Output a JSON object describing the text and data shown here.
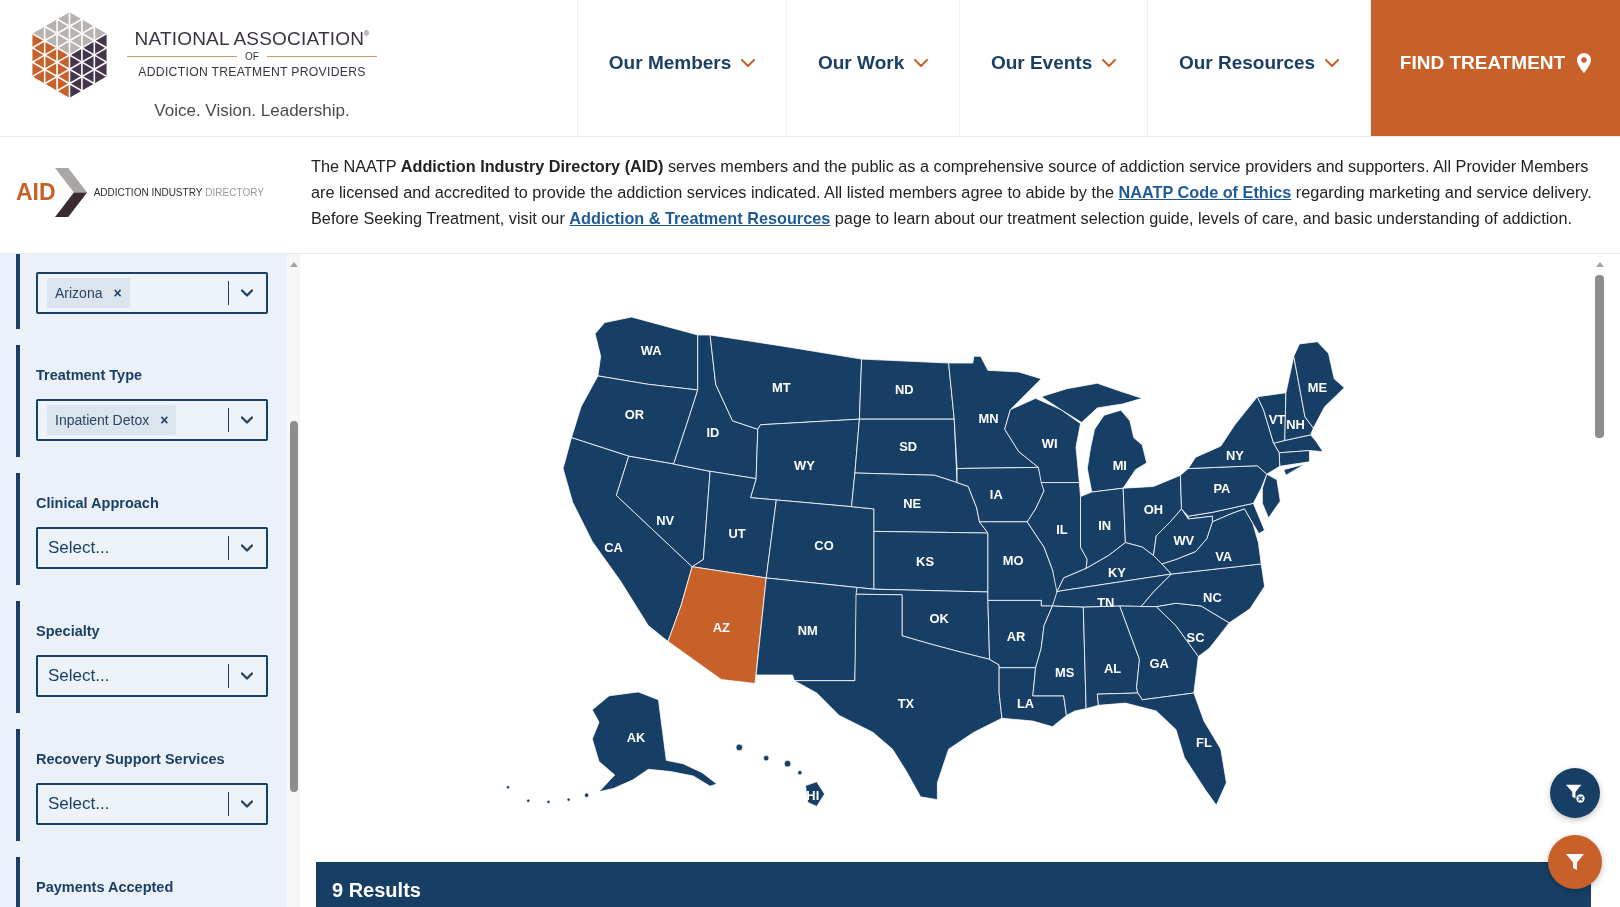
{
  "header": {
    "logo": {
      "title": "NATIONAL ASSOCIATION$^{®}$",
      "connector": "OF",
      "subtitle": "ADDICTION TREATMENT PROVIDERS",
      "tagline": "Voice. Vision. Leadership."
    },
    "nav": [
      {
        "label": "Our Members",
        "kind": "menu"
      },
      {
        "label": "Our Work",
        "kind": "menu"
      },
      {
        "label": "Our Events",
        "kind": "menu"
      },
      {
        "label": "Our Resources",
        "kind": "menu"
      },
      {
        "label": "FIND TREATMENT",
        "kind": "cta"
      }
    ]
  },
  "intro": {
    "logo": {
      "mark": "AID",
      "name": "ADDICTION INDUSTRY",
      "name_accent": "DIRECTORY"
    },
    "paragraph": [
      {
        "kind": "text",
        "text": "The NAATP **Addiction Industry Directory (AID)** serves members and the public as a comprehensive source of addiction service providers and supporters. All Provider Members are licensed and accredited to provide the addiction services indicated. All listed members agree to abide by the "
      },
      {
        "kind": "link",
        "text": "NAATP Code of Ethics"
      },
      {
        "kind": "text",
        "text": " regarding marketing and service delivery. Before Seeking Treatment, visit our "
      },
      {
        "kind": "link",
        "text": "Addiction & Treatment Resources"
      },
      {
        "kind": "text",
        "text": " page to learn about our treatment selection guide, levels of care, and basic understanding of addiction."
      }
    ]
  },
  "filters": [
    {
      "tags": [
        {
          "label": "Arizona",
          "remove": "×"
        }
      ]
    },
    {
      "label": "Treatment Type",
      "tags": [
        {
          "label": "Inpatient Detox",
          "remove": "×"
        }
      ]
    },
    {
      "label": "Clinical Approach",
      "placeholder": "Select..."
    },
    {
      "label": "Specialty",
      "placeholder": "Select..."
    },
    {
      "label": "Recovery Support Services",
      "placeholder": "Select..."
    },
    {
      "label": "Payments Accepted"
    }
  ],
  "map": {
    "states": [
      {
        "code": "WA",
        "selected": false
      },
      {
        "code": "OR",
        "selected": false
      },
      {
        "code": "CA",
        "selected": false
      },
      {
        "code": "NV",
        "selected": false
      },
      {
        "code": "ID",
        "selected": false
      },
      {
        "code": "MT",
        "selected": false
      },
      {
        "code": "WY",
        "selected": false
      },
      {
        "code": "UT",
        "selected": false
      },
      {
        "code": "AZ",
        "selected": true
      },
      {
        "code": "CO",
        "selected": false
      },
      {
        "code": "NM",
        "selected": false
      },
      {
        "code": "ND",
        "selected": false
      },
      {
        "code": "SD",
        "selected": false
      },
      {
        "code": "NE",
        "selected": false
      },
      {
        "code": "KS",
        "selected": false
      },
      {
        "code": "OK",
        "selected": false
      },
      {
        "code": "TX",
        "selected": false
      },
      {
        "code": "MN",
        "selected": false
      },
      {
        "code": "IA",
        "selected": false
      },
      {
        "code": "MO",
        "selected": false
      },
      {
        "code": "AR",
        "selected": false
      },
      {
        "code": "LA",
        "selected": false
      },
      {
        "code": "WI",
        "selected": false
      },
      {
        "code": "IL",
        "selected": false
      },
      {
        "code": "MI",
        "selected": false
      },
      {
        "code": "IN",
        "selected": false
      },
      {
        "code": "OH",
        "selected": false
      },
      {
        "code": "KY",
        "selected": false
      },
      {
        "code": "TN",
        "selected": false
      },
      {
        "code": "MS",
        "selected": false
      },
      {
        "code": "AL",
        "selected": false
      },
      {
        "code": "GA",
        "selected": false
      },
      {
        "code": "FL",
        "selected": false
      },
      {
        "code": "SC",
        "selected": false
      },
      {
        "code": "NC",
        "selected": false
      },
      {
        "code": "VA",
        "selected": false
      },
      {
        "code": "WV",
        "selected": false
      },
      {
        "code": "PA",
        "selected": false
      },
      {
        "code": "NY",
        "selected": false
      },
      {
        "code": "VT",
        "selected": false
      },
      {
        "code": "NH",
        "selected": false
      },
      {
        "code": "ME",
        "selected": false
      },
      {
        "code": "AK",
        "selected": false
      },
      {
        "code": "HI",
        "selected": false
      }
    ]
  },
  "results": {
    "count": "9 Results"
  }
}
